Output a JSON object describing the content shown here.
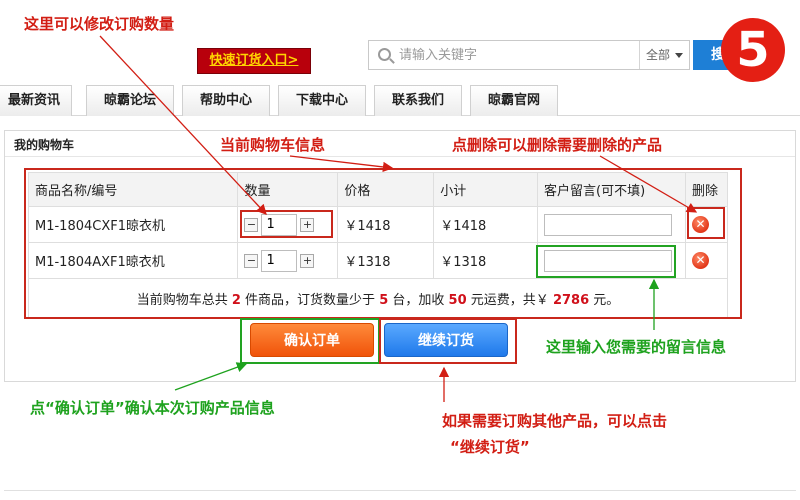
{
  "header": {
    "quick_order_label": "快速订货入口>",
    "search_placeholder": "请输入关键字",
    "search_scope": "全部",
    "search_button": "搜",
    "step_number": "5"
  },
  "nav": {
    "tabs": [
      {
        "label": "最新资讯"
      },
      {
        "label": "晾霸论坛"
      },
      {
        "label": "帮助中心"
      },
      {
        "label": "下载中心"
      },
      {
        "label": "联系我们"
      },
      {
        "label": "晾霸官网"
      }
    ]
  },
  "cart": {
    "title": "我的购物车",
    "columns": [
      "商品名称/编号",
      "数量",
      "价格",
      "小计",
      "客户留言(可不填)",
      "删除"
    ],
    "rows": [
      {
        "name": "M1-1804CXF1晾衣机",
        "qty": "1",
        "price": "￥1418",
        "subtotal": "￥1418",
        "note": ""
      },
      {
        "name": "M1-1804AXF1晾衣机",
        "qty": "1",
        "price": "￥1318",
        "subtotal": "￥1318",
        "note": ""
      }
    ],
    "summary": {
      "text1": "当前购物车总共",
      "item_count": "2",
      "text2": "件商品，订货数量少于",
      "min_qty": "5",
      "text3": "台，加收",
      "shipping_fee": "50",
      "text4": "元运费，共￥",
      "total": "2786",
      "text5": "元。"
    },
    "confirm_label": "确认订单",
    "continue_label": "继续订货"
  },
  "annotations": {
    "qty_tip": "这里可以修改订购数量",
    "cart_info_tip": "当前购物车信息",
    "delete_tip": "点删除可以删除需要删除的产品",
    "note_tip": "这里输入您需要的留言信息",
    "confirm_tip": "点“确认订单”确认本次订购产品信息",
    "continue_tip_line1": "如果需要订购其他产品，可以点击",
    "continue_tip_line2": "“继续订货”"
  }
}
